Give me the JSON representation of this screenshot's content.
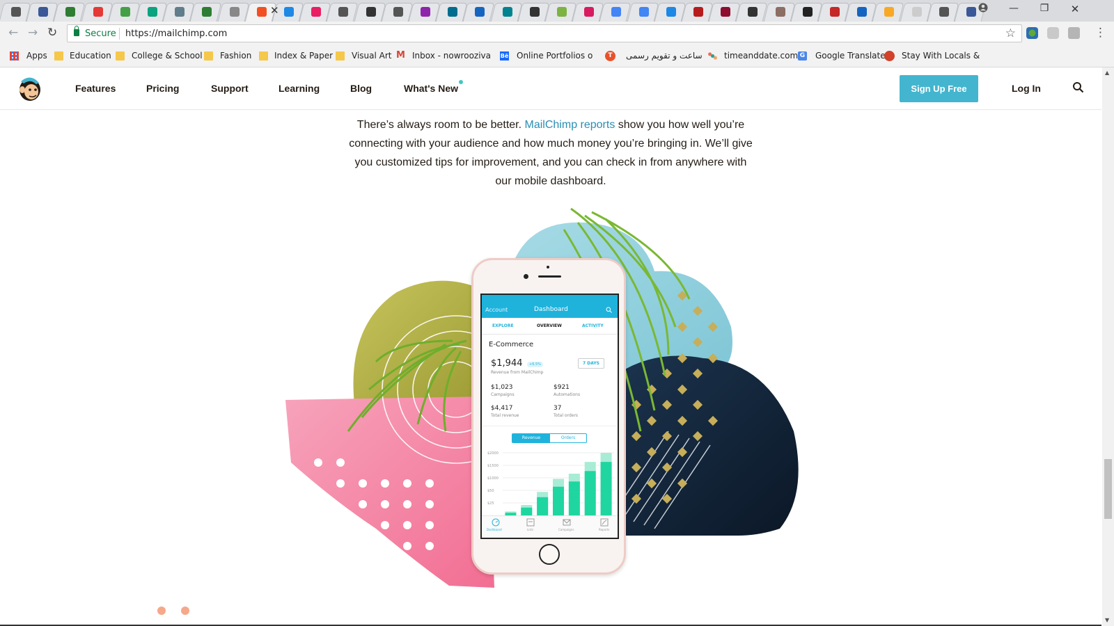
{
  "browser": {
    "tab_count": 38,
    "active_tab_label": "M",
    "window_controls": {
      "minimize": "—",
      "restore": "❐",
      "close": "✕"
    },
    "secure_label": "Secure",
    "url": "https://mailchimp.com"
  },
  "bookmarks": [
    {
      "label": "Apps",
      "icon": "apps-grid-icon"
    },
    {
      "label": "Education",
      "icon": "folder-icon"
    },
    {
      "label": "College & School",
      "icon": "folder-icon"
    },
    {
      "label": "Fashion",
      "icon": "folder-icon"
    },
    {
      "label": "Index & Paper",
      "icon": "folder-icon"
    },
    {
      "label": "Visual Art",
      "icon": "folder-icon"
    },
    {
      "label": "Inbox - nowroozivahi",
      "icon": "gmail-icon"
    },
    {
      "label": "Online Portfolios on B",
      "icon": "behance-icon"
    },
    {
      "label": "",
      "icon": "t-badge-icon"
    },
    {
      "label": "ساعت و تقویم رسمی",
      "icon": "none"
    },
    {
      "label": "timeanddate.com",
      "icon": "timeanddate-icon"
    },
    {
      "label": "Google Translate",
      "icon": "translate-icon"
    },
    {
      "label": "Stay With Locals & M",
      "icon": "globe-icon"
    }
  ],
  "nav": {
    "items": [
      "Features",
      "Pricing",
      "Support",
      "Learning",
      "Blog",
      "What's New"
    ],
    "signup": "Sign Up Free",
    "login": "Log In"
  },
  "intro": {
    "before": "There’s always room to be better. ",
    "link": "MailChimp reports",
    "after": " show you how well you’re connecting with your audience and how much money you’re bringing in. We’ll give you customized tips for improvement, and you can check in from anywhere with our mobile dashboard."
  },
  "phone": {
    "header_left": "Account",
    "header_title": "Dashboard",
    "tabs": [
      "EXPLORE",
      "OVERVIEW",
      "ACTIVITY"
    ],
    "section": "E-Commerce",
    "revenue": "$1,944",
    "revenue_change": "+6.5%",
    "revenue_label": "Revenue from MailChimp",
    "period": "7 DAYS",
    "stats": [
      {
        "value": "$1,023",
        "label": "Campaigns"
      },
      {
        "value": "$921",
        "label": "Automations"
      },
      {
        "value": "$4,417",
        "label": "Total revenue"
      },
      {
        "value": "37",
        "label": "Total orders"
      }
    ],
    "toggle": [
      "Revenue",
      "Orders"
    ],
    "y_ticks": [
      "$2000",
      "$1500",
      "$1000",
      "$50",
      "$25"
    ],
    "bottom_nav": [
      "Dashboard",
      "Lists",
      "Campaigns",
      "Reports"
    ],
    "accent": "#1fb3dc",
    "bar_color": "#1fd6a0"
  },
  "chart_data": {
    "type": "bar",
    "categories": [
      "1",
      "2",
      "3",
      "4",
      "5",
      "6",
      "7"
    ],
    "series": [
      {
        "values": [
          100,
          300,
          700,
          1100,
          1300,
          1700,
          2050
        ]
      },
      {
        "values": [
          150,
          400,
          900,
          1400,
          1600,
          2050,
          2400
        ]
      }
    ],
    "ylim": [
      0,
      2400
    ]
  },
  "carousel": {
    "dots": 2
  },
  "colors": {
    "signup": "#44b5cf",
    "link": "#2a8eb3",
    "text": "#241c15"
  }
}
